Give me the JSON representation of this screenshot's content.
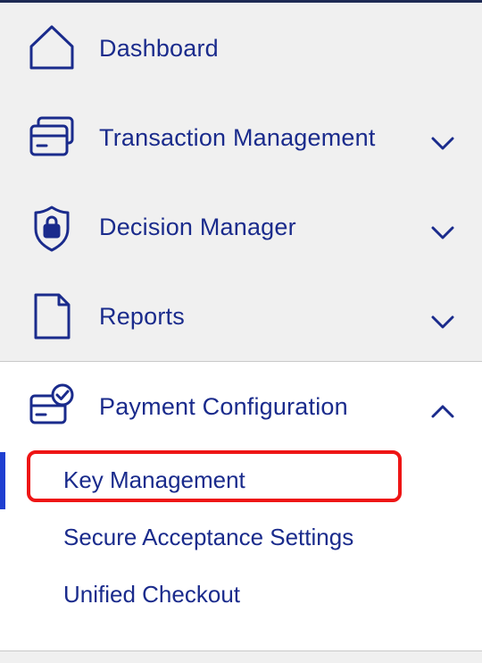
{
  "nav": {
    "items": [
      {
        "label": "Dashboard",
        "icon": "home-icon",
        "expandable": false
      },
      {
        "label": "Transaction Management",
        "icon": "cards-icon",
        "expandable": true,
        "expanded": false
      },
      {
        "label": "Decision Manager",
        "icon": "shield-lock-icon",
        "expandable": true,
        "expanded": false
      },
      {
        "label": "Reports",
        "icon": "document-icon",
        "expandable": true,
        "expanded": false
      },
      {
        "label": "Payment Configuration",
        "icon": "card-check-icon",
        "expandable": true,
        "expanded": true
      }
    ],
    "payment_configuration_subitems": [
      {
        "label": "Key Management",
        "active": true
      },
      {
        "label": "Secure Acceptance Settings",
        "active": false
      },
      {
        "label": "Unified Checkout",
        "active": false
      }
    ]
  },
  "colors": {
    "text": "#1a2b8c",
    "active_bar": "#1f3fd1",
    "highlight_box": "#ee1515",
    "section_background": "#f0f0f0"
  }
}
